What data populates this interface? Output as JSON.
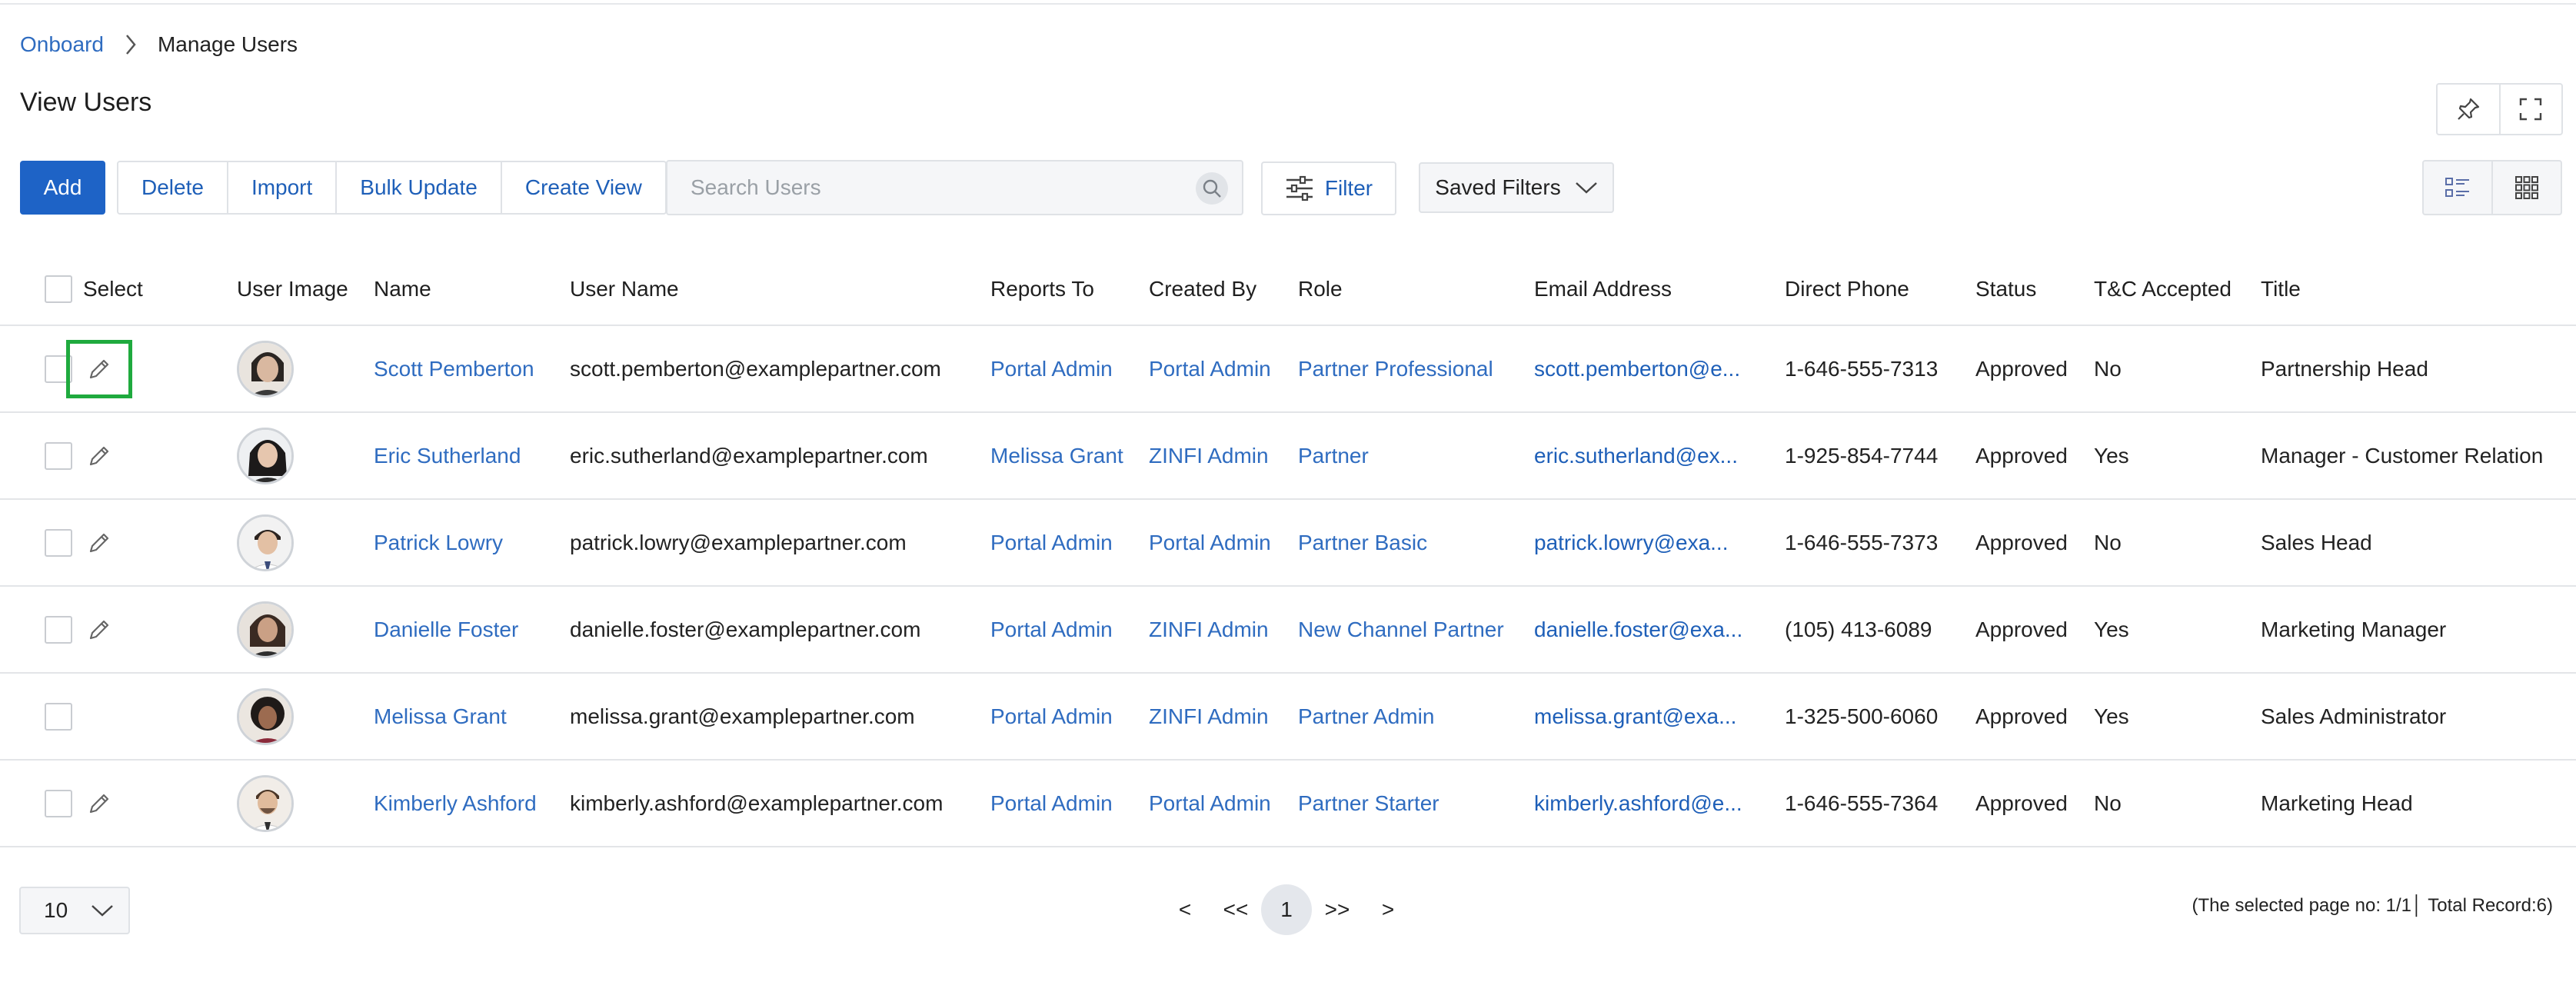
{
  "breadcrumb": {
    "root": "Onboard",
    "current": "Manage Users"
  },
  "page_title": "View Users",
  "toolbar": {
    "add": "Add",
    "delete": "Delete",
    "import": "Import",
    "bulk_update": "Bulk Update",
    "create_view": "Create View",
    "search_placeholder": "Search Users",
    "filter": "Filter",
    "saved_filters": "Saved Filters"
  },
  "columns": {
    "select": "Select",
    "image": "User Image",
    "name": "Name",
    "username": "User Name",
    "reports_to": "Reports To",
    "created_by": "Created By",
    "role": "Role",
    "email": "Email Address",
    "phone": "Direct Phone",
    "status": "Status",
    "tc": "T&C Accepted",
    "title": "Title"
  },
  "rows": [
    {
      "name": "Scott Pemberton",
      "username": "scott.pemberton@examplepartner.com",
      "reports_to": "Portal Admin",
      "created_by": "Portal Admin",
      "role": "Partner Professional",
      "email": "scott.pemberton@e...",
      "phone": "1-646-555-7313",
      "status": "Approved",
      "tc": "No",
      "title": "Partnership Head"
    },
    {
      "name": "Eric Sutherland",
      "username": "eric.sutherland@examplepartner.com",
      "reports_to": "Melissa Grant",
      "created_by": "ZINFI Admin",
      "role": "Partner",
      "email": "eric.sutherland@ex...",
      "phone": "1-925-854-7744",
      "status": "Approved",
      "tc": "Yes",
      "title": "Manager - Customer Relation"
    },
    {
      "name": "Patrick Lowry",
      "username": "patrick.lowry@examplepartner.com",
      "reports_to": "Portal Admin",
      "created_by": "Portal Admin",
      "role": "Partner Basic",
      "email": "patrick.lowry@exa...",
      "phone": "1-646-555-7373",
      "status": "Approved",
      "tc": "No",
      "title": "Sales Head"
    },
    {
      "name": "Danielle Foster",
      "username": "danielle.foster@examplepartner.com",
      "reports_to": "Portal Admin",
      "created_by": "ZINFI Admin",
      "role": "New Channel Partner",
      "email": "danielle.foster@exa...",
      "phone": "(105) 413-6089",
      "status": "Approved",
      "tc": "Yes",
      "title": "Marketing Manager"
    },
    {
      "name": "Melissa Grant",
      "username": "melissa.grant@examplepartner.com",
      "reports_to": "Portal Admin",
      "created_by": "ZINFI Admin",
      "role": "Partner Admin",
      "email": "melissa.grant@exa...",
      "phone": "1-325-500-6060",
      "status": "Approved",
      "tc": "Yes",
      "title": "Sales Administrator"
    },
    {
      "name": "Kimberly Ashford",
      "username": "kimberly.ashford@examplepartner.com",
      "reports_to": "Portal Admin",
      "created_by": "Portal Admin",
      "role": "Partner Starter",
      "email": "kimberly.ashford@e...",
      "phone": "1-646-555-7364",
      "status": "Approved",
      "tc": "No",
      "title": "Marketing Head"
    }
  ],
  "pagination": {
    "page_size": "10",
    "prev": "<",
    "first": "<<",
    "current": "1",
    "last": ">>",
    "next": ">",
    "info": "(The selected page no: 1/1│ Total Record:6)"
  },
  "colors": {
    "accent": "#1e63c6",
    "link": "#2f6cc0",
    "highlight": "#1faa3e"
  },
  "icons": [
    "chevron-right-icon",
    "pin-icon",
    "fullscreen-icon",
    "search-icon",
    "filter-sliders-icon",
    "chevron-down-icon",
    "list-view-icon",
    "grid-view-icon",
    "pencil-icon"
  ]
}
